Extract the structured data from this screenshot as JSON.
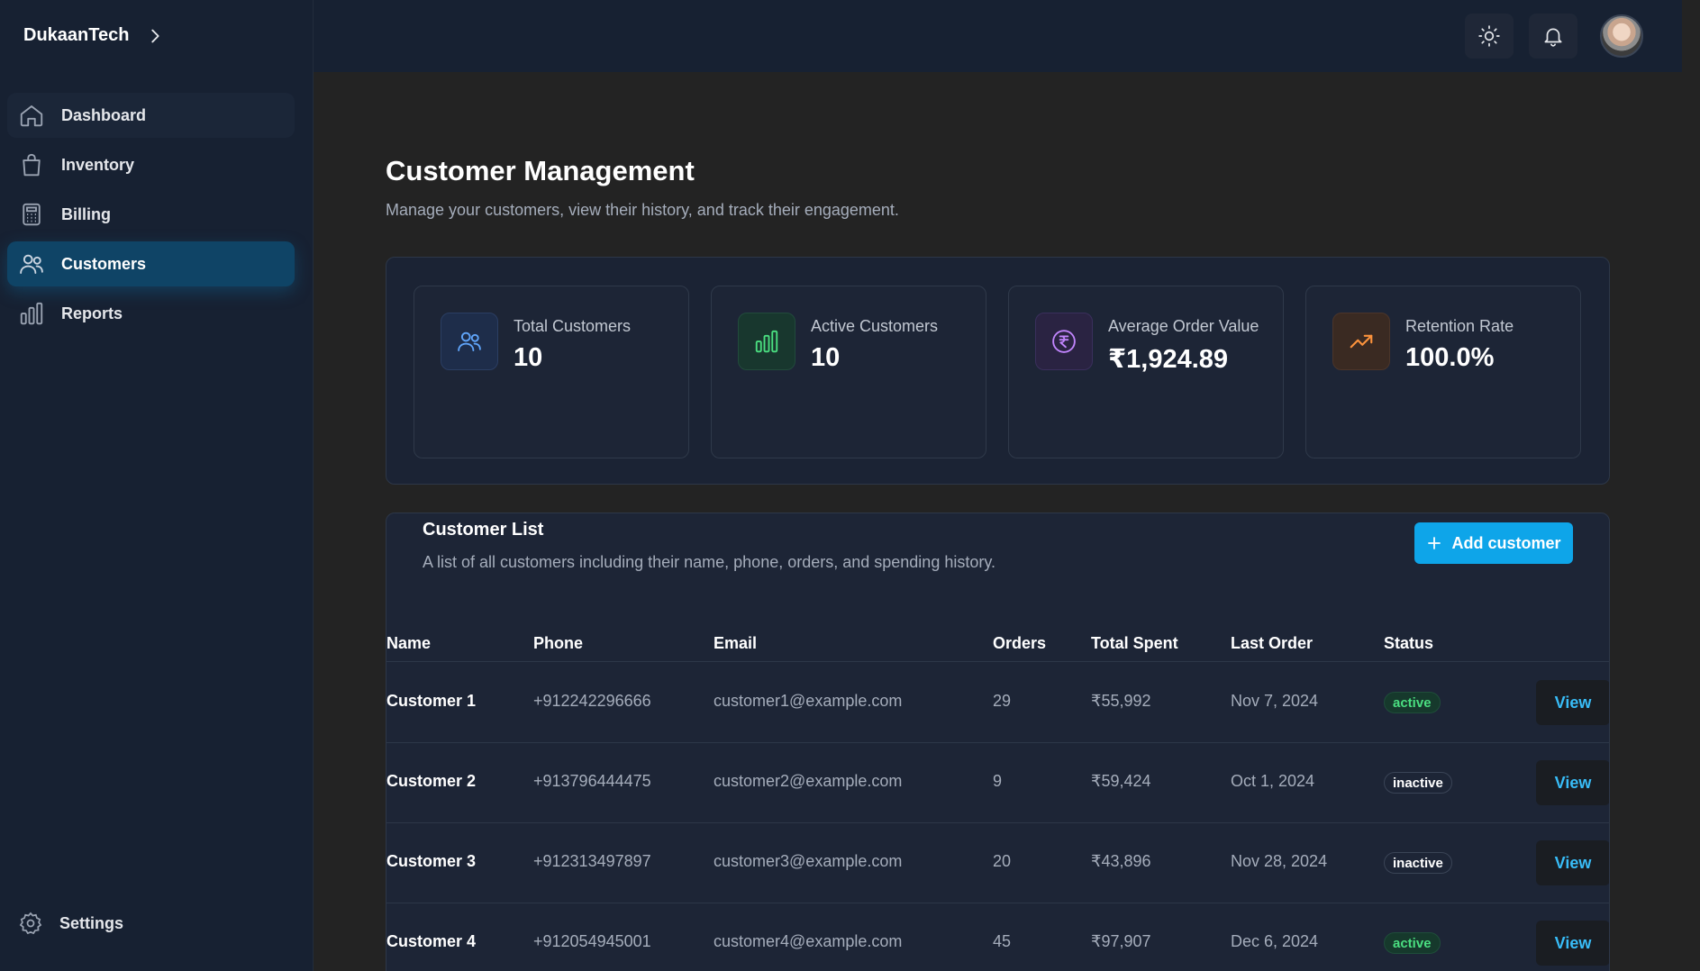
{
  "app": {
    "brand": "DukaanTech"
  },
  "sidebar": {
    "items": [
      {
        "label": "Dashboard",
        "icon": "home-icon"
      },
      {
        "label": "Inventory",
        "icon": "shopping-bag-icon"
      },
      {
        "label": "Billing",
        "icon": "calculator-icon"
      },
      {
        "label": "Customers",
        "icon": "users-icon",
        "active": true
      },
      {
        "label": "Reports",
        "icon": "bar-chart-icon"
      }
    ],
    "settings_label": "Settings"
  },
  "topbar": {
    "theme_icon": "sun-icon",
    "notifications_icon": "bell-icon",
    "avatar": "user-avatar"
  },
  "page": {
    "title": "Customer Management",
    "subtitle": "Manage your customers, view their history, and track their engagement."
  },
  "stats": [
    {
      "label": "Total Customers",
      "value": "10",
      "icon": "users-icon",
      "color": "#60a5fa"
    },
    {
      "label": "Active Customers",
      "value": "10",
      "icon": "bar-chart-icon",
      "color": "#4ade80"
    },
    {
      "label": "Average Order Value",
      "value": "₹1,924.89",
      "icon": "rupee-icon",
      "color": "#c084fc"
    },
    {
      "label": "Retention Rate",
      "value": "100.0%",
      "icon": "trending-up-icon",
      "color": "#fb923c"
    }
  ],
  "customer_list": {
    "title": "Customer List",
    "subtitle": "A list of all customers including their name, phone, orders, and spending history.",
    "add_button_label": "Add customer",
    "columns": [
      "Name",
      "Phone",
      "Email",
      "Orders",
      "Total Spent",
      "Last Order",
      "Status"
    ],
    "view_label": "View",
    "rows": [
      {
        "name": "Customer 1",
        "phone": "+912242296666",
        "email": "customer1@example.com",
        "orders": "29",
        "total_spent": "₹55,992",
        "last_order": "Nov 7, 2024",
        "status": "active"
      },
      {
        "name": "Customer 2",
        "phone": "+913796444475",
        "email": "customer2@example.com",
        "orders": "9",
        "total_spent": "₹59,424",
        "last_order": "Oct 1, 2024",
        "status": "inactive"
      },
      {
        "name": "Customer 3",
        "phone": "+912313497897",
        "email": "customer3@example.com",
        "orders": "20",
        "total_spent": "₹43,896",
        "last_order": "Nov 28, 2024",
        "status": "inactive"
      },
      {
        "name": "Customer 4",
        "phone": "+912054945001",
        "email": "customer4@example.com",
        "orders": "45",
        "total_spent": "₹97,907",
        "last_order": "Dec 6, 2024",
        "status": "active"
      }
    ]
  },
  "colors": {
    "accent": "#0ea5e9",
    "sidebar_bg": "#172132",
    "page_bg": "#232323",
    "active_nav": "#0f4466"
  }
}
